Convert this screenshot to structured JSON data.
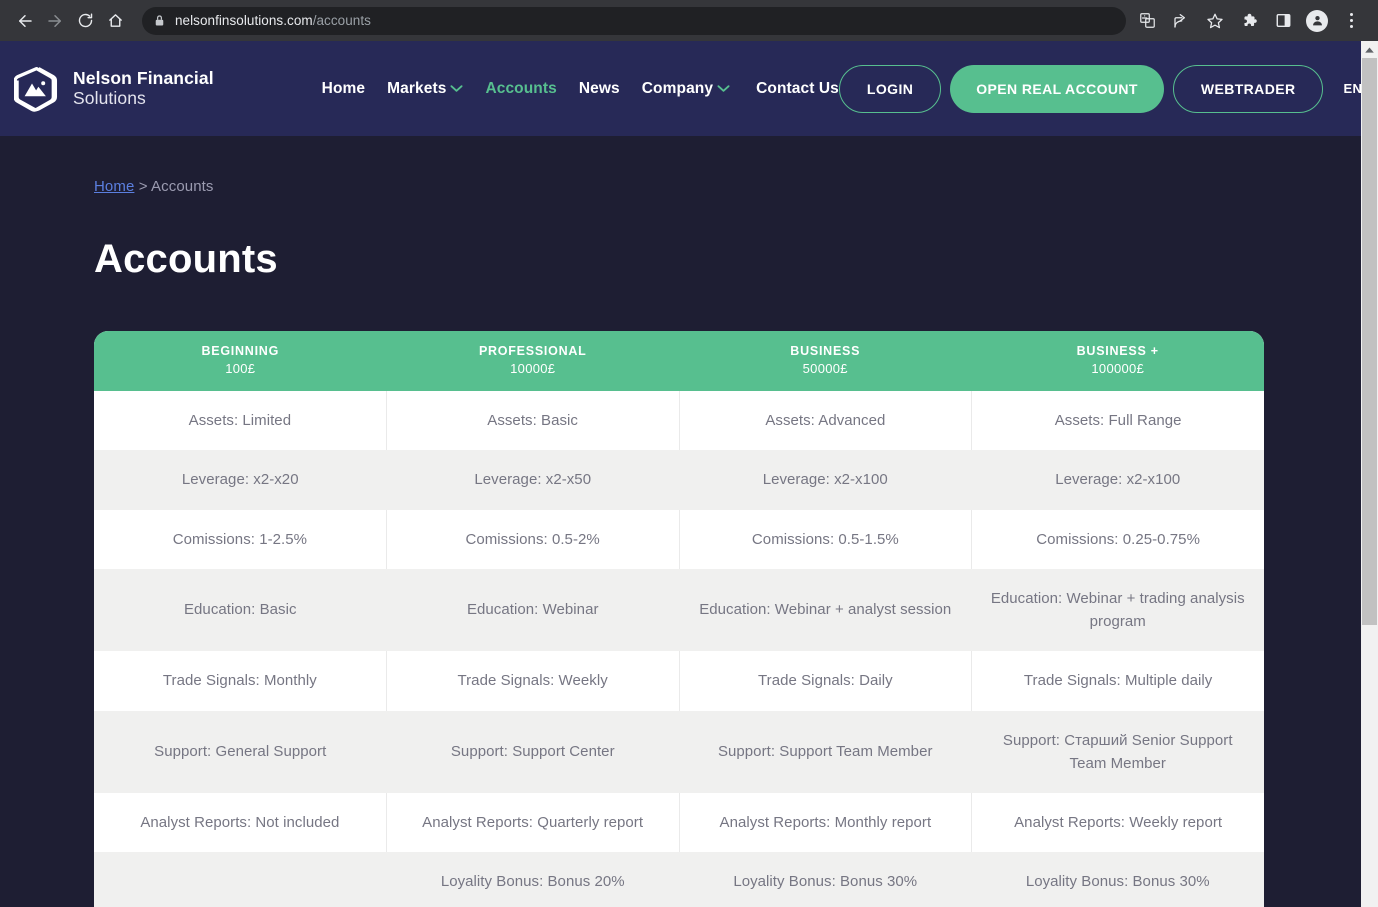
{
  "browser": {
    "back_label": "Back",
    "forward_label": "Forward",
    "reload_label": "Reload",
    "home_label": "Home",
    "lock_icon": "lock-icon",
    "url_domain": "nelsonfinsolutions.com",
    "url_path": "/accounts",
    "toolbar_icons": [
      "translate-icon",
      "share-icon",
      "bookmark-star-icon",
      "extensions-puzzle-icon",
      "sidepanel-icon",
      "profile-avatar-icon",
      "overflow-menu-icon"
    ]
  },
  "site": {
    "brand": {
      "logo_icon": "hexagon-mountain-logo",
      "line1": "Nelson Financial",
      "line2": "Solutions"
    },
    "nav": [
      {
        "label": "Home",
        "active": false,
        "caret": false
      },
      {
        "label": "Markets",
        "active": false,
        "caret": true
      },
      {
        "label": "Accounts",
        "active": true,
        "caret": false
      },
      {
        "label": "News",
        "active": false,
        "caret": false
      },
      {
        "label": "Company",
        "active": false,
        "caret": true
      },
      {
        "label": "Contact Us",
        "active": false,
        "caret": false
      }
    ],
    "actions": {
      "login": "LOGIN",
      "open_real_account": "OPEN REAL ACCOUNT",
      "webtrader": "WEBTRADER",
      "language": "EN"
    },
    "colors": {
      "header_bg": "#272957",
      "page_bg": "#1e1e33",
      "accent_green": "#57bf8f",
      "link_blue": "#5b7fe0",
      "row_alt_bg": "#f0f0ef",
      "cell_text": "#767683"
    }
  },
  "page": {
    "breadcrumb": {
      "home": "Home",
      "separator": ">",
      "current": "Accounts"
    },
    "title": "Accounts"
  },
  "table": {
    "columns": [
      {
        "name": "BEGINNING",
        "price": "100£"
      },
      {
        "name": "PROFESSIONAL",
        "price": "10000£"
      },
      {
        "name": "BUSINESS",
        "price": "50000£"
      },
      {
        "name": "BUSINESS +",
        "price": "100000£"
      }
    ],
    "rows": [
      {
        "key": "assets",
        "cells": [
          "Assets: Limited",
          "Assets: Basic",
          "Assets: Advanced",
          "Assets: Full Range"
        ]
      },
      {
        "key": "leverage",
        "cells": [
          "Leverage: x2-x20",
          "Leverage: x2-x50",
          "Leverage: x2-x100",
          "Leverage: x2-x100"
        ]
      },
      {
        "key": "comissions",
        "cells": [
          "Comissions: 1-2.5%",
          "Comissions: 0.5-2%",
          "Comissions: 0.5-1.5%",
          "Comissions: 0.25-0.75%"
        ]
      },
      {
        "key": "education",
        "cells": [
          "Education: Basic",
          "Education: Webinar",
          "Education: Webinar + analyst session",
          "Education: Webinar + trading analysis program"
        ]
      },
      {
        "key": "trade-signals",
        "cells": [
          "Trade Signals: Monthly",
          "Trade Signals: Weekly",
          "Trade Signals: Daily",
          "Trade Signals: Multiple daily"
        ]
      },
      {
        "key": "support",
        "cells": [
          "Support: General Support",
          "Support: Support Center",
          "Support: Support Team Member",
          "Support: Старший Senior Support Team Member"
        ]
      },
      {
        "key": "analyst-reports",
        "cells": [
          "Analyst Reports: Not included",
          "Analyst Reports: Quarterly report",
          "Analyst Reports: Monthly report",
          "Analyst Reports: Weekly report"
        ]
      },
      {
        "key": "loyality-bonus",
        "cells": [
          "",
          "Loyality Bonus: Bonus 20%",
          "Loyality Bonus: Bonus 30%",
          "Loyality Bonus: Bonus 30%"
        ]
      }
    ]
  }
}
